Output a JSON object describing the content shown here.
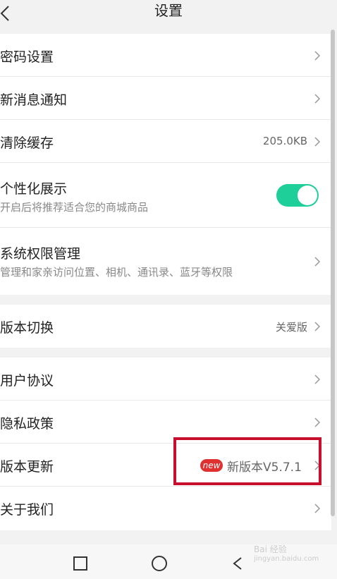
{
  "header": {
    "title": "设置",
    "back_icon": "chevron-left-icon"
  },
  "group1": [
    {
      "title": "密码设置",
      "value": "",
      "subtitle": ""
    },
    {
      "title": "新消息通知",
      "value": "",
      "subtitle": ""
    },
    {
      "title": "清除缓存",
      "value": "205.0KB",
      "subtitle": ""
    },
    {
      "title": "个性化展示",
      "subtitle": "开启后将推荐适合您的商城商品",
      "toggle": true
    },
    {
      "title": "系统权限管理",
      "subtitle": "管理和家亲访问位置、相机、通讯录、蓝牙等权限"
    }
  ],
  "group2": [
    {
      "title": "版本切换",
      "value": "关爱版"
    }
  ],
  "group3": [
    {
      "title": "用户协议"
    },
    {
      "title": "隐私政策"
    },
    {
      "title": "版本更新",
      "badge": "new",
      "value": "新版本V5.7.1"
    },
    {
      "title": "关于我们"
    }
  ],
  "navbar": {
    "icons": [
      "square-icon",
      "circle-icon",
      "triangle-back-icon"
    ]
  },
  "watermark": {
    "text": "Bai 经验",
    "sub": "jingyan.baidu.com"
  },
  "colors": {
    "accent": "#1fcf9a",
    "highlight": "#c8102e",
    "badge": "#e03030"
  }
}
